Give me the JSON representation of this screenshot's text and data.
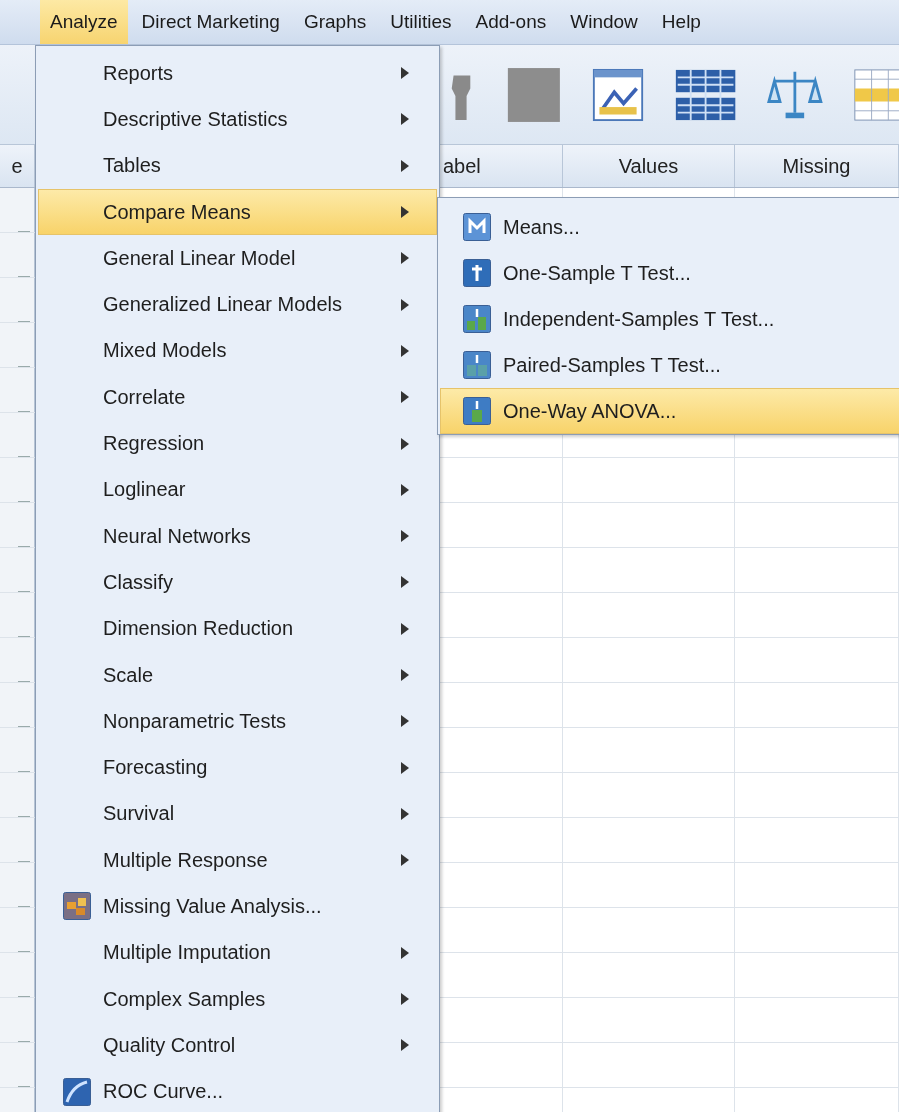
{
  "menu_bar": {
    "items": [
      {
        "label": "Analyze",
        "selected": true
      },
      {
        "label": "Direct Marketing",
        "selected": false
      },
      {
        "label": "Graphs",
        "selected": false
      },
      {
        "label": "Utilities",
        "selected": false
      },
      {
        "label": "Add-ons",
        "selected": false
      },
      {
        "label": "Window",
        "selected": false
      },
      {
        "label": "Help",
        "selected": false
      }
    ]
  },
  "grid": {
    "columns": [
      "e",
      "abel",
      "Values",
      "Missing"
    ]
  },
  "analyze_menu": {
    "items": [
      {
        "label": "Reports",
        "kind": "submenu",
        "selected": false
      },
      {
        "label": "Descriptive Statistics",
        "kind": "submenu",
        "selected": false
      },
      {
        "label": "Tables",
        "kind": "submenu",
        "selected": false
      },
      {
        "label": "Compare Means",
        "kind": "submenu",
        "selected": true
      },
      {
        "label": "General Linear Model",
        "kind": "submenu",
        "selected": false
      },
      {
        "label": "Generalized Linear Models",
        "kind": "submenu",
        "selected": false
      },
      {
        "label": "Mixed Models",
        "kind": "submenu",
        "selected": false
      },
      {
        "label": "Correlate",
        "kind": "submenu",
        "selected": false
      },
      {
        "label": "Regression",
        "kind": "submenu",
        "selected": false
      },
      {
        "label": "Loglinear",
        "kind": "submenu",
        "selected": false
      },
      {
        "label": "Neural Networks",
        "kind": "submenu",
        "selected": false
      },
      {
        "label": "Classify",
        "kind": "submenu",
        "selected": false
      },
      {
        "label": "Dimension Reduction",
        "kind": "submenu",
        "selected": false
      },
      {
        "label": "Scale",
        "kind": "submenu",
        "selected": false
      },
      {
        "label": "Nonparametric Tests",
        "kind": "submenu",
        "selected": false
      },
      {
        "label": "Forecasting",
        "kind": "submenu",
        "selected": false
      },
      {
        "label": "Survival",
        "kind": "submenu",
        "selected": false
      },
      {
        "label": "Multiple Response",
        "kind": "submenu",
        "selected": false
      },
      {
        "label": "Missing Value Analysis...",
        "kind": "command",
        "selected": false
      },
      {
        "label": "Multiple Imputation",
        "kind": "submenu",
        "selected": false
      },
      {
        "label": "Complex Samples",
        "kind": "submenu",
        "selected": false
      },
      {
        "label": "Quality Control",
        "kind": "submenu",
        "selected": false
      },
      {
        "label": "ROC Curve...",
        "kind": "command",
        "selected": false
      }
    ]
  },
  "compare_means_menu": {
    "items": [
      {
        "label": "Means...",
        "selected": false
      },
      {
        "label": "One-Sample T Test...",
        "selected": false
      },
      {
        "label": "Independent-Samples T Test...",
        "selected": false
      },
      {
        "label": "Paired-Samples T Test...",
        "selected": false
      },
      {
        "label": "One-Way ANOVA...",
        "selected": true
      }
    ]
  }
}
